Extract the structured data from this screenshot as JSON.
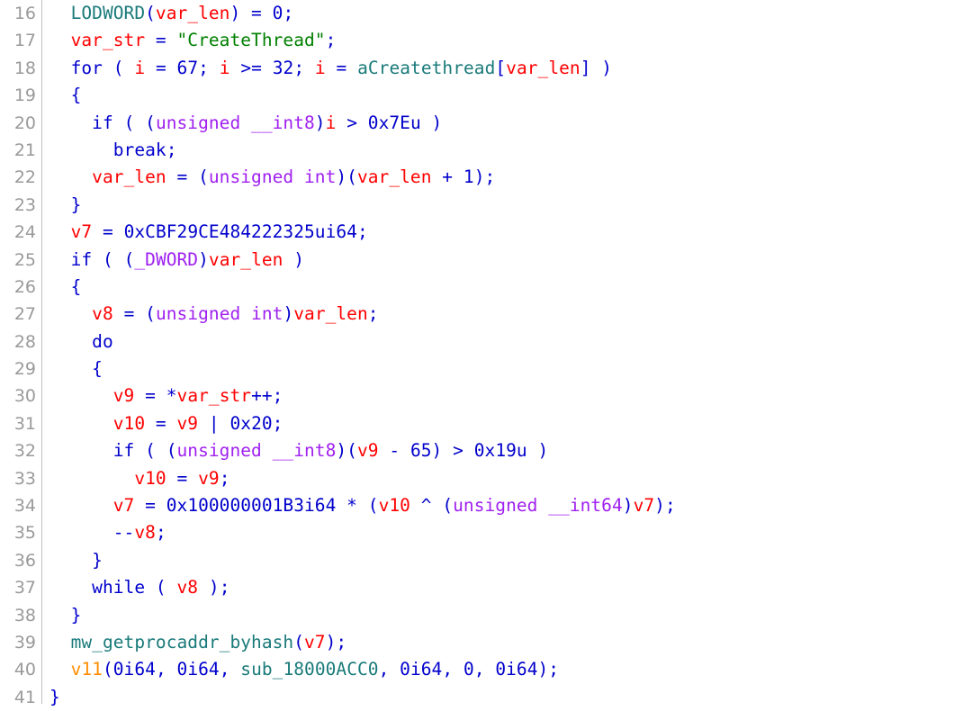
{
  "editor": {
    "kind": "decompiler-pseudocode-view",
    "background_color": "#ffffff",
    "gutter_separator_color": "#bdbdbd",
    "line_number_color": "#9a9a9a",
    "first_line_number": 16,
    "last_line_number": 41,
    "palette": {
      "variable": "#ff0000",
      "keyword": "#0000cc",
      "number": "#0000cc",
      "punctuation": "#0000cc",
      "function": "#1a7a7a",
      "type_cast": "#a020f0",
      "string": "#008000",
      "highlighted_variable": "#ff8c00",
      "plain": "#000000"
    },
    "lines": [
      {
        "number": "16",
        "text": "  LODWORD(var_len) = 0;",
        "tokens": [
          {
            "t": "  ",
            "c": "plain"
          },
          {
            "t": "LODWORD",
            "c": "fn"
          },
          {
            "t": "(",
            "c": "punct"
          },
          {
            "t": "var_len",
            "c": "var"
          },
          {
            "t": ")",
            "c": "punct"
          },
          {
            "t": " ",
            "c": "plain"
          },
          {
            "t": "=",
            "c": "punct"
          },
          {
            "t": " ",
            "c": "plain"
          },
          {
            "t": "0",
            "c": "num"
          },
          {
            "t": ";",
            "c": "punct"
          }
        ]
      },
      {
        "number": "17",
        "text": "  var_str = \"CreateThread\";",
        "tokens": [
          {
            "t": "  ",
            "c": "plain"
          },
          {
            "t": "var_str",
            "c": "var"
          },
          {
            "t": " ",
            "c": "plain"
          },
          {
            "t": "=",
            "c": "punct"
          },
          {
            "t": " ",
            "c": "plain"
          },
          {
            "t": "\"CreateThread\"",
            "c": "str"
          },
          {
            "t": ";",
            "c": "punct"
          }
        ]
      },
      {
        "number": "18",
        "text": "  for ( i = 67; i >= 32; i = aCreatethread[var_len] )",
        "tokens": [
          {
            "t": "  ",
            "c": "plain"
          },
          {
            "t": "for",
            "c": "kw"
          },
          {
            "t": " ",
            "c": "plain"
          },
          {
            "t": "(",
            "c": "punct"
          },
          {
            "t": " ",
            "c": "plain"
          },
          {
            "t": "i",
            "c": "var"
          },
          {
            "t": " ",
            "c": "plain"
          },
          {
            "t": "=",
            "c": "punct"
          },
          {
            "t": " ",
            "c": "plain"
          },
          {
            "t": "67",
            "c": "num"
          },
          {
            "t": "; ",
            "c": "punct"
          },
          {
            "t": "i",
            "c": "var"
          },
          {
            "t": " ",
            "c": "plain"
          },
          {
            "t": ">=",
            "c": "punct"
          },
          {
            "t": " ",
            "c": "plain"
          },
          {
            "t": "32",
            "c": "num"
          },
          {
            "t": "; ",
            "c": "punct"
          },
          {
            "t": "i",
            "c": "var"
          },
          {
            "t": " ",
            "c": "plain"
          },
          {
            "t": "=",
            "c": "punct"
          },
          {
            "t": " ",
            "c": "plain"
          },
          {
            "t": "aCreatethread",
            "c": "fn"
          },
          {
            "t": "[",
            "c": "punct"
          },
          {
            "t": "var_len",
            "c": "var"
          },
          {
            "t": "] )",
            "c": "punct"
          }
        ]
      },
      {
        "number": "19",
        "text": "  {",
        "tokens": [
          {
            "t": "  ",
            "c": "plain"
          },
          {
            "t": "{",
            "c": "punct"
          }
        ]
      },
      {
        "number": "20",
        "text": "    if ( (unsigned __int8)i > 0x7Eu )",
        "tokens": [
          {
            "t": "    ",
            "c": "plain"
          },
          {
            "t": "if",
            "c": "kw"
          },
          {
            "t": " ",
            "c": "plain"
          },
          {
            "t": "( (",
            "c": "punct"
          },
          {
            "t": "unsigned __int8",
            "c": "type"
          },
          {
            "t": ")",
            "c": "punct"
          },
          {
            "t": "i",
            "c": "var"
          },
          {
            "t": " ",
            "c": "plain"
          },
          {
            "t": ">",
            "c": "punct"
          },
          {
            "t": " ",
            "c": "plain"
          },
          {
            "t": "0x7Eu",
            "c": "num"
          },
          {
            "t": " )",
            "c": "punct"
          }
        ]
      },
      {
        "number": "21",
        "text": "      break;",
        "tokens": [
          {
            "t": "      ",
            "c": "plain"
          },
          {
            "t": "break",
            "c": "kw"
          },
          {
            "t": ";",
            "c": "punct"
          }
        ]
      },
      {
        "number": "22",
        "text": "    var_len = (unsigned int)(var_len + 1);",
        "tokens": [
          {
            "t": "    ",
            "c": "plain"
          },
          {
            "t": "var_len",
            "c": "var"
          },
          {
            "t": " ",
            "c": "plain"
          },
          {
            "t": "=",
            "c": "punct"
          },
          {
            "t": " ",
            "c": "plain"
          },
          {
            "t": "(",
            "c": "punct"
          },
          {
            "t": "unsigned int",
            "c": "type"
          },
          {
            "t": ")(",
            "c": "punct"
          },
          {
            "t": "var_len",
            "c": "var"
          },
          {
            "t": " ",
            "c": "plain"
          },
          {
            "t": "+",
            "c": "punct"
          },
          {
            "t": " ",
            "c": "plain"
          },
          {
            "t": "1",
            "c": "num"
          },
          {
            "t": ");",
            "c": "punct"
          }
        ]
      },
      {
        "number": "23",
        "text": "  }",
        "tokens": [
          {
            "t": "  ",
            "c": "plain"
          },
          {
            "t": "}",
            "c": "punct"
          }
        ]
      },
      {
        "number": "24",
        "text": "  v7 = 0xCBF29CE484222325ui64;",
        "tokens": [
          {
            "t": "  ",
            "c": "plain"
          },
          {
            "t": "v7",
            "c": "var"
          },
          {
            "t": " ",
            "c": "plain"
          },
          {
            "t": "=",
            "c": "punct"
          },
          {
            "t": " ",
            "c": "plain"
          },
          {
            "t": "0xCBF29CE484222325ui64",
            "c": "num"
          },
          {
            "t": ";",
            "c": "punct"
          }
        ]
      },
      {
        "number": "25",
        "text": "  if ( (_DWORD)var_len )",
        "tokens": [
          {
            "t": "  ",
            "c": "plain"
          },
          {
            "t": "if",
            "c": "kw"
          },
          {
            "t": " ",
            "c": "plain"
          },
          {
            "t": "( (",
            "c": "punct"
          },
          {
            "t": "_DWORD",
            "c": "type"
          },
          {
            "t": ")",
            "c": "punct"
          },
          {
            "t": "var_len",
            "c": "var"
          },
          {
            "t": " )",
            "c": "punct"
          }
        ]
      },
      {
        "number": "26",
        "text": "  {",
        "tokens": [
          {
            "t": "  ",
            "c": "plain"
          },
          {
            "t": "{",
            "c": "punct"
          }
        ]
      },
      {
        "number": "27",
        "text": "    v8 = (unsigned int)var_len;",
        "tokens": [
          {
            "t": "    ",
            "c": "plain"
          },
          {
            "t": "v8",
            "c": "var"
          },
          {
            "t": " ",
            "c": "plain"
          },
          {
            "t": "=",
            "c": "punct"
          },
          {
            "t": " ",
            "c": "plain"
          },
          {
            "t": "(",
            "c": "punct"
          },
          {
            "t": "unsigned int",
            "c": "type"
          },
          {
            "t": ")",
            "c": "punct"
          },
          {
            "t": "var_len",
            "c": "var"
          },
          {
            "t": ";",
            "c": "punct"
          }
        ]
      },
      {
        "number": "28",
        "text": "    do",
        "tokens": [
          {
            "t": "    ",
            "c": "plain"
          },
          {
            "t": "do",
            "c": "kw"
          }
        ]
      },
      {
        "number": "29",
        "text": "    {",
        "tokens": [
          {
            "t": "    ",
            "c": "plain"
          },
          {
            "t": "{",
            "c": "punct"
          }
        ]
      },
      {
        "number": "30",
        "text": "      v9 = *var_str++;",
        "tokens": [
          {
            "t": "      ",
            "c": "plain"
          },
          {
            "t": "v9",
            "c": "var"
          },
          {
            "t": " ",
            "c": "plain"
          },
          {
            "t": "=",
            "c": "punct"
          },
          {
            "t": " ",
            "c": "plain"
          },
          {
            "t": "*",
            "c": "punct"
          },
          {
            "t": "var_str",
            "c": "var"
          },
          {
            "t": "++;",
            "c": "punct"
          }
        ]
      },
      {
        "number": "31",
        "text": "      v10 = v9 | 0x20;",
        "tokens": [
          {
            "t": "      ",
            "c": "plain"
          },
          {
            "t": "v10",
            "c": "var"
          },
          {
            "t": " ",
            "c": "plain"
          },
          {
            "t": "=",
            "c": "punct"
          },
          {
            "t": " ",
            "c": "plain"
          },
          {
            "t": "v9",
            "c": "var"
          },
          {
            "t": " ",
            "c": "plain"
          },
          {
            "t": "|",
            "c": "punct"
          },
          {
            "t": " ",
            "c": "plain"
          },
          {
            "t": "0x20",
            "c": "num"
          },
          {
            "t": ";",
            "c": "punct"
          }
        ]
      },
      {
        "number": "32",
        "text": "      if ( (unsigned __int8)(v9 - 65) > 0x19u )",
        "tokens": [
          {
            "t": "      ",
            "c": "plain"
          },
          {
            "t": "if",
            "c": "kw"
          },
          {
            "t": " ",
            "c": "plain"
          },
          {
            "t": "( (",
            "c": "punct"
          },
          {
            "t": "unsigned __int8",
            "c": "type"
          },
          {
            "t": ")(",
            "c": "punct"
          },
          {
            "t": "v9",
            "c": "var"
          },
          {
            "t": " ",
            "c": "plain"
          },
          {
            "t": "-",
            "c": "punct"
          },
          {
            "t": " ",
            "c": "plain"
          },
          {
            "t": "65",
            "c": "num"
          },
          {
            "t": ")",
            "c": "punct"
          },
          {
            "t": " ",
            "c": "plain"
          },
          {
            "t": ">",
            "c": "punct"
          },
          {
            "t": " ",
            "c": "plain"
          },
          {
            "t": "0x19u",
            "c": "num"
          },
          {
            "t": " )",
            "c": "punct"
          }
        ]
      },
      {
        "number": "33",
        "text": "        v10 = v9;",
        "tokens": [
          {
            "t": "        ",
            "c": "plain"
          },
          {
            "t": "v10",
            "c": "var"
          },
          {
            "t": " ",
            "c": "plain"
          },
          {
            "t": "=",
            "c": "punct"
          },
          {
            "t": " ",
            "c": "plain"
          },
          {
            "t": "v9",
            "c": "var"
          },
          {
            "t": ";",
            "c": "punct"
          }
        ]
      },
      {
        "number": "34",
        "text": "      v7 = 0x100000001B3i64 * (v10 ^ (unsigned __int64)v7);",
        "tokens": [
          {
            "t": "      ",
            "c": "plain"
          },
          {
            "t": "v7",
            "c": "var"
          },
          {
            "t": " ",
            "c": "plain"
          },
          {
            "t": "=",
            "c": "punct"
          },
          {
            "t": " ",
            "c": "plain"
          },
          {
            "t": "0x100000001B3i64",
            "c": "num"
          },
          {
            "t": " ",
            "c": "plain"
          },
          {
            "t": "*",
            "c": "punct"
          },
          {
            "t": " ",
            "c": "plain"
          },
          {
            "t": "(",
            "c": "punct"
          },
          {
            "t": "v10",
            "c": "var"
          },
          {
            "t": " ",
            "c": "plain"
          },
          {
            "t": "^",
            "c": "punct"
          },
          {
            "t": " ",
            "c": "plain"
          },
          {
            "t": "(",
            "c": "punct"
          },
          {
            "t": "unsigned __int64",
            "c": "type"
          },
          {
            "t": ")",
            "c": "punct"
          },
          {
            "t": "v7",
            "c": "var"
          },
          {
            "t": ");",
            "c": "punct"
          }
        ]
      },
      {
        "number": "35",
        "text": "      --v8;",
        "tokens": [
          {
            "t": "      ",
            "c": "plain"
          },
          {
            "t": "--",
            "c": "punct"
          },
          {
            "t": "v8",
            "c": "var"
          },
          {
            "t": ";",
            "c": "punct"
          }
        ]
      },
      {
        "number": "36",
        "text": "    }",
        "tokens": [
          {
            "t": "    ",
            "c": "plain"
          },
          {
            "t": "}",
            "c": "punct"
          }
        ]
      },
      {
        "number": "37",
        "text": "    while ( v8 );",
        "tokens": [
          {
            "t": "    ",
            "c": "plain"
          },
          {
            "t": "while",
            "c": "kw"
          },
          {
            "t": " ",
            "c": "plain"
          },
          {
            "t": "( ",
            "c": "punct"
          },
          {
            "t": "v8",
            "c": "var"
          },
          {
            "t": " );",
            "c": "punct"
          }
        ]
      },
      {
        "number": "38",
        "text": "  }",
        "tokens": [
          {
            "t": "  ",
            "c": "plain"
          },
          {
            "t": "}",
            "c": "punct"
          }
        ]
      },
      {
        "number": "39",
        "text": "  mw_getprocaddr_byhash(v7);",
        "tokens": [
          {
            "t": "  ",
            "c": "plain"
          },
          {
            "t": "mw_getprocaddr_byhash",
            "c": "fn"
          },
          {
            "t": "(",
            "c": "punct"
          },
          {
            "t": "v7",
            "c": "var"
          },
          {
            "t": ");",
            "c": "punct"
          }
        ]
      },
      {
        "number": "40",
        "text": "  v11(0i64, 0i64, sub_18000ACC0, 0i64, 0, 0i64);",
        "tokens": [
          {
            "t": "  ",
            "c": "plain"
          },
          {
            "t": "v11",
            "c": "orange"
          },
          {
            "t": "(",
            "c": "punct"
          },
          {
            "t": "0i64",
            "c": "num"
          },
          {
            "t": ", ",
            "c": "punct"
          },
          {
            "t": "0i64",
            "c": "num"
          },
          {
            "t": ", ",
            "c": "punct"
          },
          {
            "t": "sub_18000ACC0",
            "c": "fn"
          },
          {
            "t": ", ",
            "c": "punct"
          },
          {
            "t": "0i64",
            "c": "num"
          },
          {
            "t": ", ",
            "c": "punct"
          },
          {
            "t": "0",
            "c": "num"
          },
          {
            "t": ", ",
            "c": "punct"
          },
          {
            "t": "0i64",
            "c": "num"
          },
          {
            "t": ");",
            "c": "punct"
          }
        ]
      },
      {
        "number": "41",
        "text": "}",
        "tokens": [
          {
            "t": "}",
            "c": "punct"
          }
        ]
      }
    ]
  }
}
